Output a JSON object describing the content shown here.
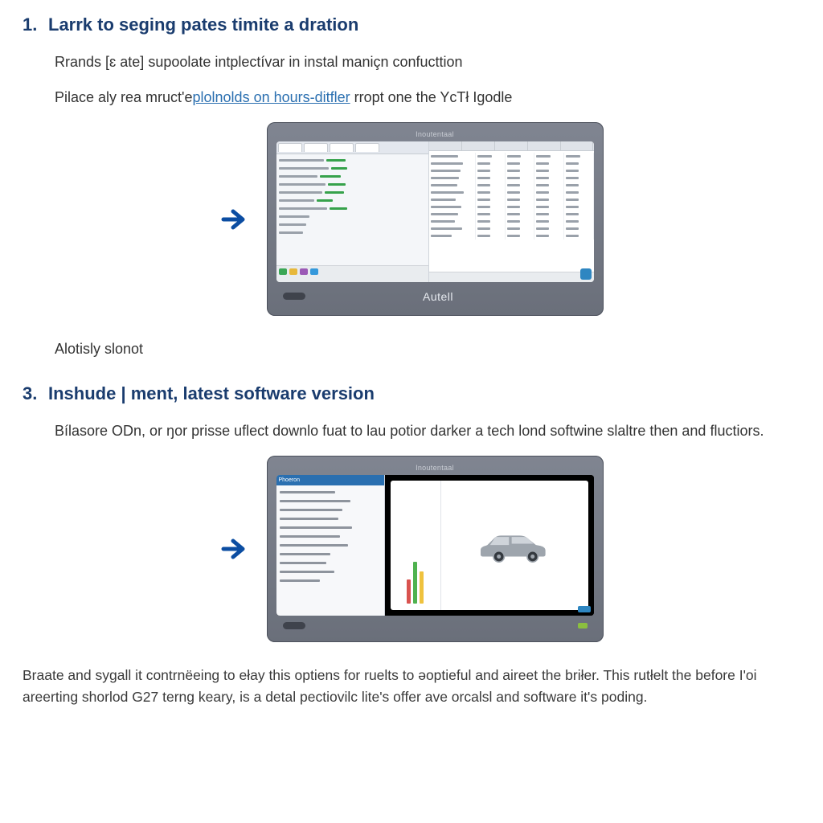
{
  "step1": {
    "number": "1.",
    "title": "Larrk to seging pates timite a dration",
    "p1_pre": "Rrands ",
    "p1_bracket": "[ɛ ate]",
    "p1_post": " supoolate intplectívar in instal maniçn confucttion",
    "p2_pre": "Pilace aly rea mruct'e",
    "p2_link": "plolnolds on hours-ditfler",
    "p2_post": " rropt one the YcTł Igodle",
    "caption": "Alotisly slonot"
  },
  "step3": {
    "number": "3.",
    "title": "Inshude | ment, latest software version",
    "p1": "Bílasore ODn, or ŋor prisse uflect downlo fuat to lau potior darker a tech lond softwine slaltre then and fluctiors."
  },
  "footer": "Braate and sygall it contrnëeing to ełay this optiens for ruelts to əoptieful and aireet the briłer. This rutłelt the before I'oi areerting shorlod G27 terng keary, is a detal pectiovilc lite's offer ave orcalsl and software it's poding.",
  "device": {
    "top_label": "Inoutentaal",
    "brand": "Autell",
    "screen2_head": "Phoeron"
  },
  "colors": {
    "heading": "#1a3c6e",
    "link": "#2a6fb0",
    "arrow": "#0b4da2"
  }
}
